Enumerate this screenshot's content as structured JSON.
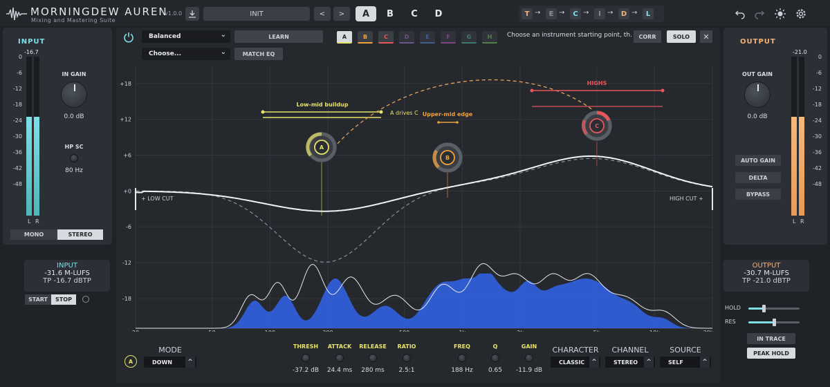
{
  "app": {
    "title": "MORNINGDEW AUREN",
    "subtitle": "Mixing and Mastering Suite",
    "version": "v1.0.0"
  },
  "preset": {
    "name": "INIT",
    "prev": "<",
    "next": ">"
  },
  "slots": [
    "A",
    "B",
    "C",
    "D"
  ],
  "active_slot": "A",
  "chain": [
    {
      "label": "T",
      "color": "#f2b37a"
    },
    {
      "label": "E",
      "color": "#8c8f94"
    },
    {
      "label": "C",
      "color": "#7de0e6"
    },
    {
      "label": "I",
      "color": "#8c8f94"
    },
    {
      "label": "D",
      "color": "#f2b37a"
    },
    {
      "label": "L",
      "color": "#7de0e6"
    }
  ],
  "chain_arrow": "→",
  "input": {
    "title": "INPUT",
    "peak": "-16.7",
    "scale": [
      "0",
      "-6",
      "-12",
      "-18",
      "-24",
      "-30",
      "-36",
      "-42",
      "-48"
    ],
    "gain_label": "IN GAIN",
    "gain_value": "0.0 dB",
    "hpsc_label": "HP SC",
    "hpsc_value": "80 Hz",
    "channels": [
      "L",
      "R"
    ],
    "mono": "MONO",
    "stereo": "STEREO",
    "level_l": 0.62,
    "level_r": 0.62,
    "lufs_title": "INPUT",
    "lufs": "-31.6 M-LUFS",
    "tp": "TP -16.7 dBTP",
    "start": "START",
    "stop": "STOP"
  },
  "output": {
    "title": "OUTPUT",
    "peak": "-21.0",
    "scale": [
      "0",
      "-6",
      "-12",
      "-18",
      "-24",
      "-30",
      "-36",
      "-42",
      "-48"
    ],
    "gain_label": "OUT GAIN",
    "gain_value": "0.0 dB",
    "auto_gain": "AUTO GAIN",
    "delta": "DELTA",
    "bypass": "BYPASS",
    "channels": [
      "L",
      "R"
    ],
    "level_l": 0.62,
    "level_r": 0.62,
    "lufs_title": "OUTPUT",
    "lufs": "-30.7 M-LUFS",
    "tp": "TP -21.0 dBTP",
    "hold_label": "HOLD",
    "res_label": "RES",
    "hold_value": 0.3,
    "res_value": 0.5,
    "in_trace": "IN TRACE",
    "peak_hold": "PEAK HOLD"
  },
  "eq_controls": {
    "profile": "Balanced",
    "instrument": "Choose...",
    "learn": "LEARN",
    "match_eq": "MATCH EQ",
    "bands": [
      {
        "label": "A",
        "color": "#e8e36a"
      },
      {
        "label": "B",
        "color": "#f0a13c"
      },
      {
        "label": "C",
        "color": "#e8555a"
      },
      {
        "label": "D",
        "color": "#a67bd1"
      },
      {
        "label": "E",
        "color": "#5a8fd8"
      },
      {
        "label": "F",
        "color": "#c860c8"
      },
      {
        "label": "G",
        "color": "#58c0a0"
      },
      {
        "label": "H",
        "color": "#7ac860"
      }
    ],
    "hint": "Choose an instrument starting point, th...",
    "corr": "CORR",
    "solo": "SOLO",
    "close": "✕"
  },
  "graph": {
    "y_ticks": [
      "+18",
      "+12",
      "+6",
      "+0",
      "-6",
      "-12",
      "-18"
    ],
    "x_ticks": [
      "20",
      "50",
      "100",
      "200",
      "500",
      "1k",
      "2k",
      "5k",
      "10k",
      "20k"
    ],
    "low_cut": "+ LOW CUT",
    "high_cut": "HIGH CUT +",
    "annotations": {
      "lowmid": "Low-mid buildup",
      "drives": "A drives C",
      "uppermid": "Upper-mid edge",
      "highs": "HIGHS"
    },
    "nodes": [
      {
        "label": "A",
        "color": "#e8e36a"
      },
      {
        "label": "B",
        "color": "#f0a13c"
      },
      {
        "label": "C",
        "color": "#e8555a"
      }
    ]
  },
  "dynamics": {
    "band_badge": "A",
    "mode_label": "MODE",
    "mode_value": "DOWN",
    "params": [
      {
        "label": "THRESH",
        "value": "-37.2 dB",
        "color": "#e8e36a"
      },
      {
        "label": "ATTACK",
        "value": "24.4 ms",
        "color": "#e8e36a"
      },
      {
        "label": "RELEASE",
        "value": "280 ms",
        "color": "#e8e36a"
      },
      {
        "label": "RATIO",
        "value": "2.5:1",
        "color": "#e8e36a"
      },
      {
        "label": "FREQ",
        "value": "188 Hz",
        "color": "#e8e36a"
      },
      {
        "label": "Q",
        "value": "0.65",
        "color": "#e8e36a"
      },
      {
        "label": "GAIN",
        "value": "-11.9 dB",
        "color": "#e8e36a"
      }
    ],
    "character_label": "CHARACTER",
    "character_value": "CLASSIC",
    "channel_label": "CHANNEL",
    "channel_value": "STEREO",
    "source_label": "SOURCE",
    "source_value": "SELF"
  }
}
